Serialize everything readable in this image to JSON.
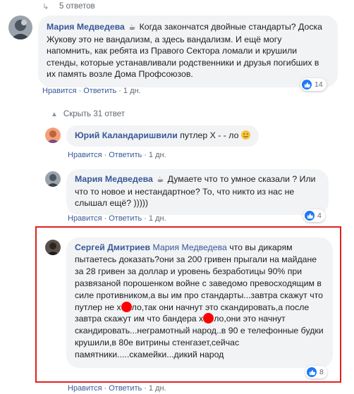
{
  "top_replies": {
    "label": "5 ответов"
  },
  "comments": [
    {
      "author": "Мария Медведева",
      "text": "Когда закончатся двойные стандарты? Доска Жукову это не вандализм, а здесь вандализм. И ещё могу напомнить, как ребята из Правого Сектора ломали и крушили стенды, которые устанавливали родственники и друзья погибших в их память возле Дома Профсоюзов.",
      "like": "Нравится",
      "reply": "Ответить",
      "time": "1 дн.",
      "reactions": "14"
    }
  ],
  "collapse": {
    "label": "Скрыть 31 ответ"
  },
  "replies": [
    {
      "author": "Юрий Каландаришвили",
      "text": "путлер Х - - ло",
      "like": "Нравится",
      "reply": "Ответить",
      "time": "1 дн."
    },
    {
      "author": "Мария Медведева",
      "text": "Думаете что то умное сказали ? Или что то новое и нестандартное? То, что никто из нас не слышал ещё? )))))",
      "like": "Нравится",
      "reply": "Ответить",
      "time": "1 дн.",
      "reactions": "4"
    },
    {
      "author": "Сергей Дмитриев",
      "mention": "Мария Медведева",
      "text_part1": "что вы дикарям пытаетесь доказать?они за 200 гривен прыгали на майдане за 28 гривен за доллар и уровень безработицы 90% при развязаной порошенком войне с заведомо превосходящим в силе противником,а вы им про стандарты...завтра скажут что путлер не х",
      "text_part2": "ло,так они начнут это скандировать,а после завтра скажут им что бандера х",
      "text_part3": "ло,они это начнут скандировать...неграмотный народ..в 90 е телефонные будки крушили,в 80е витрины стенгазет,сейчас памятники.....скамейки...дикий народ",
      "like": "Нравится",
      "reply": "Ответить",
      "time": "1 дн.",
      "reactions": "8"
    }
  ],
  "colors": {
    "link": "#385898",
    "bubble": "#f2f3f5",
    "like_blue": "#2078f4",
    "highlight": "#e02020",
    "redact": "#ff0000"
  }
}
